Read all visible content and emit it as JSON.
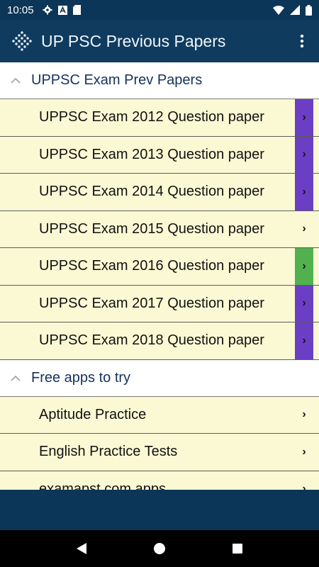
{
  "status_bar": {
    "time": "10:05",
    "left_icons": [
      "gear-icon",
      "a-text-icon",
      "sd-card-icon"
    ],
    "right_icons": [
      "wifi-icon",
      "cellular-signal-icon",
      "battery-icon"
    ]
  },
  "app_bar": {
    "title": "UP PSC Previous Papers",
    "logo_icon": "diamond-grid-logo-icon",
    "menu_icon": "overflow-menu-icon"
  },
  "colors": {
    "status_bar": "#0c3658",
    "app_bar": "#0f3b5f",
    "row_background": "#fbf9d4",
    "header_text": "#16325c",
    "accent_purple": "#6a3fc4",
    "accent_green": "#52b14f"
  },
  "groups": [
    {
      "title": "UPPSC Exam Prev Papers",
      "items": [
        {
          "label": "UPPSC Exam 2012 Question paper",
          "arrow": "›",
          "accent": "purple"
        },
        {
          "label": "UPPSC Exam 2013 Question paper",
          "arrow": "›",
          "accent": "purple"
        },
        {
          "label": "UPPSC Exam 2014 Question paper",
          "arrow": "›",
          "accent": "purple"
        },
        {
          "label": "UPPSC Exam 2015 Question paper",
          "arrow": "›",
          "accent": "none"
        },
        {
          "label": "UPPSC Exam 2016 Question paper",
          "arrow": "›",
          "accent": "green"
        },
        {
          "label": "UPPSC Exam 2017 Question paper",
          "arrow": "›",
          "accent": "purple"
        },
        {
          "label": "UPPSC Exam 2018 Question paper",
          "arrow": "›",
          "accent": "purple"
        }
      ]
    },
    {
      "title": "Free apps to try",
      "items": [
        {
          "label": "Aptitude Practice",
          "arrow": "›",
          "accent": "none"
        },
        {
          "label": "English Practice Tests",
          "arrow": "›",
          "accent": "none"
        },
        {
          "label": "examapst.com apps",
          "arrow": "›",
          "accent": "none"
        }
      ]
    }
  ],
  "nav_bar": {
    "back_icon": "back-triangle-icon",
    "home_icon": "home-circle-icon",
    "recents_icon": "recents-square-icon"
  }
}
